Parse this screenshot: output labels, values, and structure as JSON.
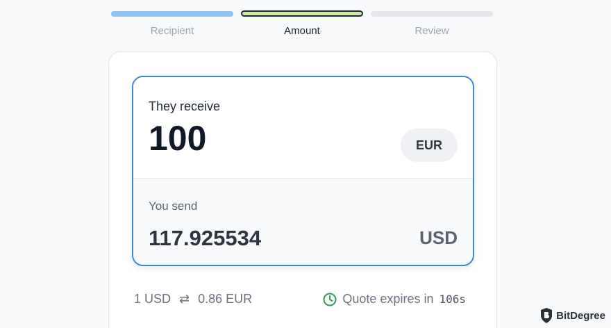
{
  "stepper": {
    "steps": [
      {
        "label": "Recipient",
        "state": "done"
      },
      {
        "label": "Amount",
        "state": "active"
      },
      {
        "label": "Review",
        "state": "pending"
      }
    ]
  },
  "converter": {
    "receive": {
      "label": "They receive",
      "amount": "100",
      "currency": "EUR"
    },
    "send": {
      "label": "You send",
      "amount": "117.925534",
      "currency": "USD"
    }
  },
  "rate": {
    "from": "1 USD",
    "to": "0.86 EUR"
  },
  "quote": {
    "text": "Quote expires in",
    "seconds": "106s"
  },
  "watermark": {
    "text": "BitDegree"
  },
  "colors": {
    "accent": "#3d87d9",
    "active_step": "#cfe8a6",
    "done_step": "#8ec5f7",
    "clock": "#2e9e5b"
  },
  "icons": {
    "swap": "swap-arrows-icon",
    "clock": "clock-icon",
    "logo": "bitdegree-shield-icon"
  }
}
